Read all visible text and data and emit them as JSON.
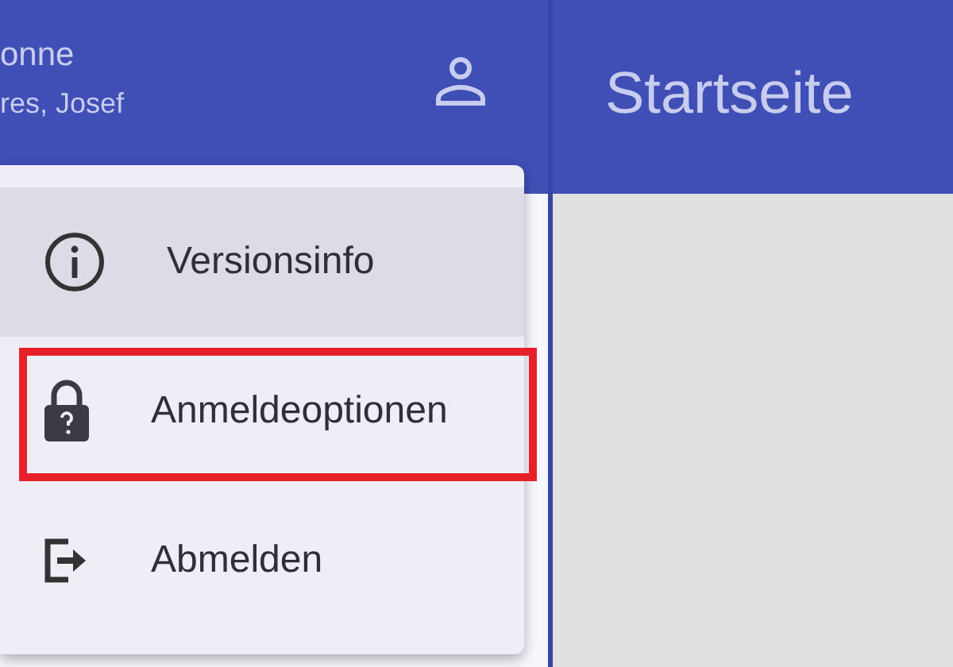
{
  "user": {
    "name": "onne",
    "subtitle": "res, Josef"
  },
  "header": {
    "title": "Startseite"
  },
  "menu": {
    "items": [
      {
        "kind": "info",
        "label": "Versionsinfo",
        "hovered": true,
        "highlighted": false
      },
      {
        "kind": "lock",
        "label": "Anmeldeoptionen",
        "hovered": false,
        "highlighted": true
      },
      {
        "kind": "logout",
        "label": "Abmelden",
        "hovered": false,
        "highlighted": false
      }
    ]
  }
}
